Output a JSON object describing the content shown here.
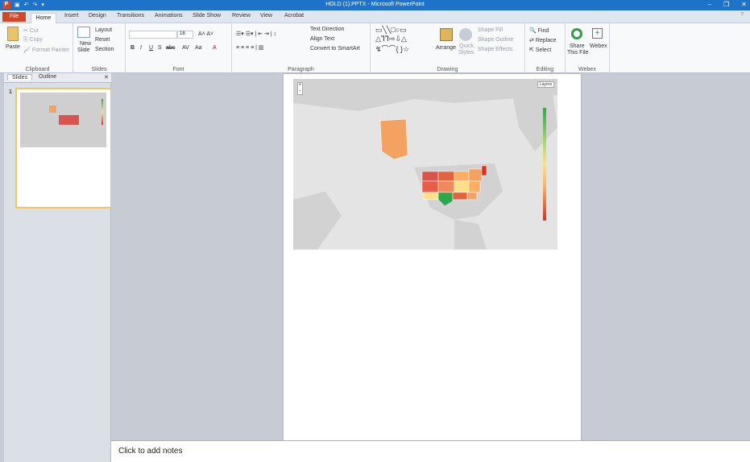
{
  "titlebar": {
    "title": "HOLD (1).PPTX - Microsoft PowerPoint",
    "app_icon": "P"
  },
  "tabs": [
    "File",
    "Home",
    "Insert",
    "Design",
    "Transitions",
    "Animations",
    "Slide Show",
    "Review",
    "View",
    "Acrobat"
  ],
  "ribbon": {
    "clipboard": {
      "paste": "Paste",
      "cut": "Cut",
      "copy": "Copy",
      "format_painter": "Format Painter",
      "label": "Clipboard"
    },
    "slides": {
      "new_slide": "New",
      "new_slide2": "Slide",
      "layout": "Layout",
      "reset": "Reset",
      "section": "Section",
      "label": "Slides"
    },
    "font": {
      "size": "18",
      "label": "Font"
    },
    "paragraph": {
      "text_direction": "Text Direction",
      "align_text": "Align Text",
      "convert_smartart": "Convert to SmartArt",
      "label": "Paragraph"
    },
    "drawing": {
      "arrange": "Arrange",
      "quick_styles": "Quick",
      "quick_styles2": "Styles",
      "shape_fill": "Shape Fill",
      "shape_outline": "Shape Outline",
      "shape_effects": "Shape Effects",
      "label": "Drawing"
    },
    "editing": {
      "find": "Find",
      "replace": "Replace",
      "select": "Select",
      "label": "Editing"
    },
    "webex": {
      "share": "Share",
      "share2": "This File",
      "webex": "Webex",
      "label": "Webex"
    }
  },
  "slide_pane": {
    "tab_slides": "Slides",
    "tab_outline": "Outline",
    "slide_number": "1"
  },
  "map": {
    "layers_label": "Layers",
    "zoom_in": "+",
    "zoom_out": "−"
  },
  "notes": {
    "placeholder": "Click to add notes"
  },
  "colors": {
    "accent": "#1e73c9",
    "file_tab": "#d24726",
    "selected_border": "#f4c55d"
  }
}
